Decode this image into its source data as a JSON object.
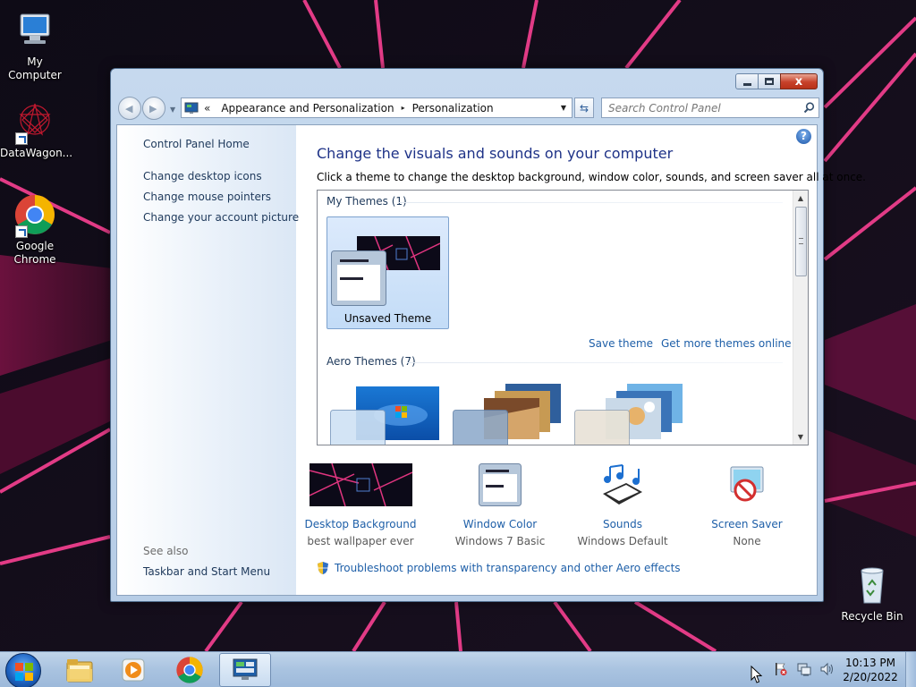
{
  "desktop": {
    "icons": [
      {
        "label": "My Computer",
        "icon": "computer-icon"
      },
      {
        "label": "DataWagon...",
        "icon": "datawagon-icon"
      },
      {
        "label": "Google Chrome",
        "icon": "chrome-icon"
      },
      {
        "label": "Recycle Bin",
        "icon": "recycle-bin-icon"
      }
    ]
  },
  "window": {
    "caption_buttons": {
      "minimize": "–",
      "maximize": "□",
      "close": "x"
    },
    "address": {
      "overflow": "«",
      "crumbs": [
        "Appearance and Personalization",
        "Personalization"
      ],
      "separator": "▸"
    },
    "search": {
      "placeholder": "Search Control Panel"
    },
    "sidebar": {
      "home": "Control Panel Home",
      "links": [
        "Change desktop icons",
        "Change mouse pointers",
        "Change your account picture"
      ],
      "see_also_label": "See also",
      "see_also_links": [
        "Taskbar and Start Menu"
      ]
    },
    "main": {
      "title": "Change the visuals and sounds on your computer",
      "subtitle": "Click a theme to change the desktop background, window color, sounds, and screen saver all at once.",
      "my_themes": {
        "heading": "My Themes (1)",
        "themes": [
          {
            "name": "Unsaved Theme",
            "selected": true
          }
        ]
      },
      "save_theme": "Save theme",
      "get_more_themes": "Get more themes online",
      "aero_themes": {
        "heading": "Aero Themes (7)"
      },
      "settings": [
        {
          "label": "Desktop Background",
          "value": "best wallpaper ever",
          "icon": "wallpaper-thumb-icon"
        },
        {
          "label": "Window Color",
          "value": "Windows 7 Basic",
          "icon": "window-color-icon"
        },
        {
          "label": "Sounds",
          "value": "Windows Default",
          "icon": "sounds-icon"
        },
        {
          "label": "Screen Saver",
          "value": "None",
          "icon": "screen-saver-icon"
        }
      ],
      "troubleshoot": "Troubleshoot problems with transparency and other Aero effects"
    }
  },
  "taskbar": {
    "clock_time": "10:13 PM",
    "clock_date": "2/20/2022"
  },
  "colors": {
    "wallpaper_base": "#120f1a",
    "wallpaper_accent": "#e0357f",
    "link": "#1e5fa8",
    "title": "#1e3287",
    "sidebar_link": "#1e395b"
  }
}
